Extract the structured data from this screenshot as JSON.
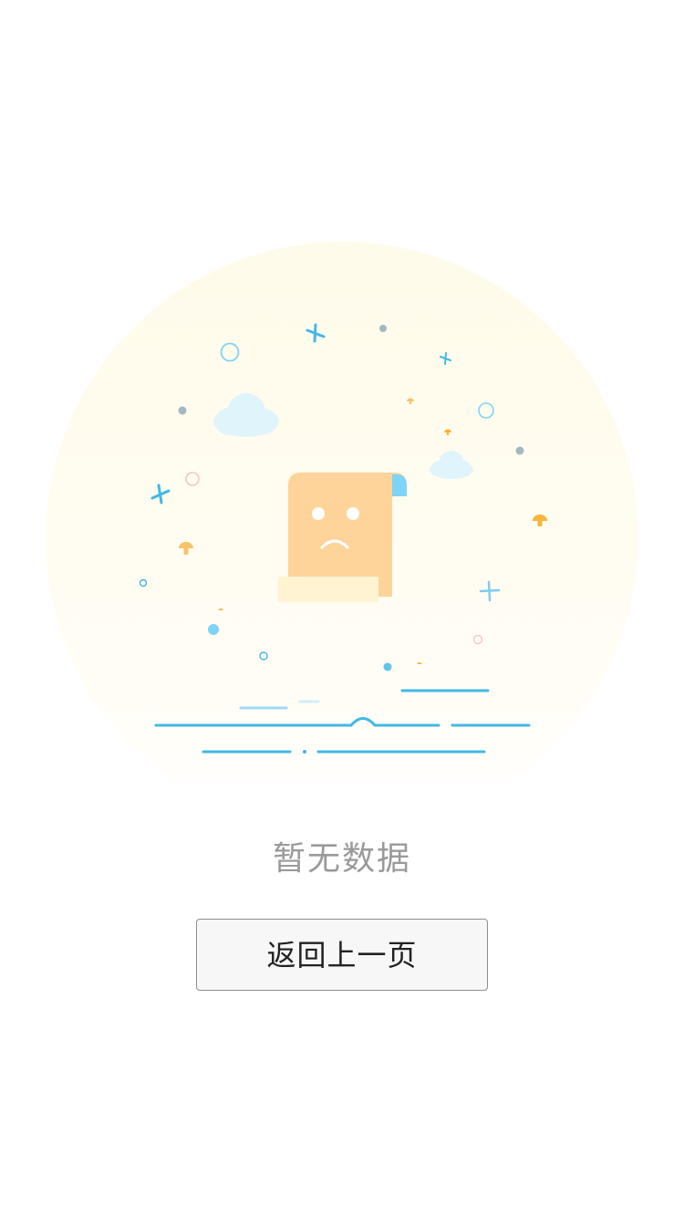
{
  "empty_state": {
    "message": "暂无数据",
    "back_button_label": "返回上一页",
    "illustration": {
      "icon": "empty-document-sad-icon",
      "colors": {
        "background_glow": "#fffbea",
        "document": "#fed49a",
        "document_roll": "#fff3d1",
        "document_corner": "#7fd3f5",
        "accent_blue": "#42b8e6",
        "light_blue": "#9fdcf6",
        "cloud": "#e0f4fc",
        "mushroom": "#f9b43a",
        "dot_gray": "#a3b9bf",
        "ring_pink": "#f1c6cc"
      }
    }
  }
}
